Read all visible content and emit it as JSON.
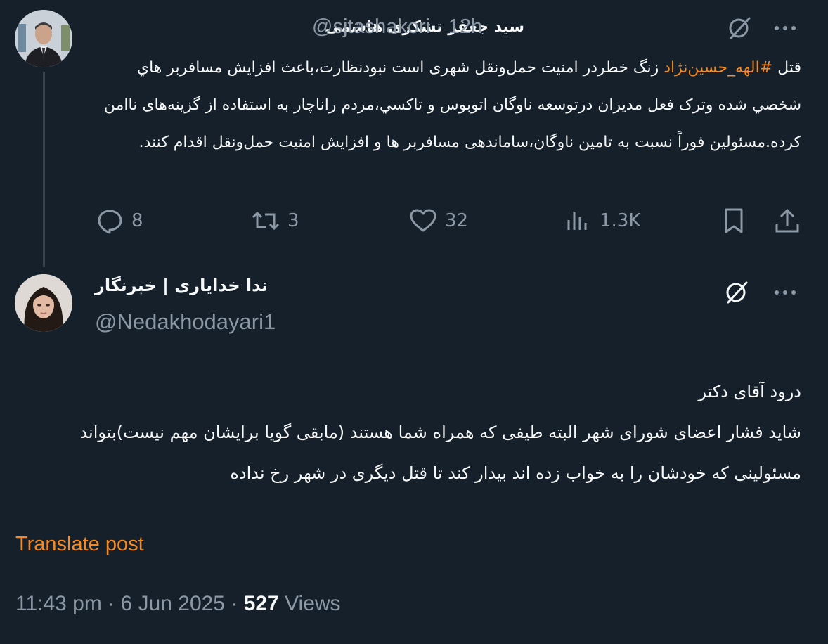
{
  "post1": {
    "author_name": "سید جعفر تشکری هاشمی",
    "handle": "@sjtashakori",
    "separator": "·",
    "time": "12h",
    "text_prefix": "قتل ",
    "hashtag": "#الهه_حسین‌نژاد",
    "text_rest": " زنگ خطردر امنیت حمل‌ونقل شهری است نبودنظارت،باعث افزایش مسافربر هاي شخصي شده وترک فعل مدیران درتوسعه ناوگان اتوبوس و تاكسي،مردم راناچار به استفاده از گزینه‌های ناامن کرده.مسئولین فوراً نسبت به تامین ناوگان،ساماندهی مسافربر ها و افزایش امنیت حمل‌ونقل اقدام کنند.",
    "replies": "8",
    "reposts": "3",
    "likes": "32",
    "views": "1.3K"
  },
  "post2": {
    "author_name": "ندا خدایاری | خبرنگار",
    "handle": "@Nedakhodayari1",
    "text_line1": "درود آقای دکتر",
    "text_body": "شاید فشار اعضای شورای شهر البته طیفی که همراه شما هستند (مابقی گویا برایشان مهم نیست)بتواند مسئولینی که خودشان را به خواب زده اند بیدار کند تا قتل دیگری در شهر رخ نداده",
    "translate_label": "Translate post",
    "time": "11:43 pm",
    "date": "6 Jun 2025",
    "views_count": "527",
    "views_label": "Views"
  },
  "icons": {
    "grok": "grok-icon",
    "more": "more-icon",
    "reply": "reply-icon",
    "repost": "repost-icon",
    "like": "like-icon",
    "views": "views-icon",
    "bookmark": "bookmark-icon",
    "share": "share-icon"
  },
  "colors": {
    "background": "#15202b",
    "accent": "#f6891f",
    "secondary_text": "#8b98a5"
  }
}
